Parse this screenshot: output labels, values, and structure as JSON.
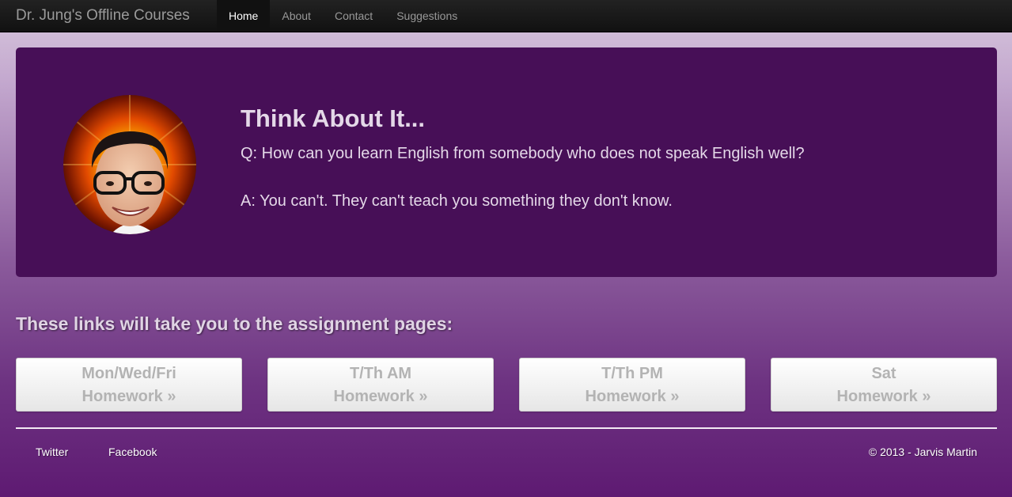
{
  "navbar": {
    "brand": "Dr. Jung's Offline Courses",
    "items": [
      {
        "label": "Home",
        "active": true
      },
      {
        "label": "About",
        "active": false
      },
      {
        "label": "Contact",
        "active": false
      },
      {
        "label": "Suggestions",
        "active": false
      }
    ]
  },
  "hero": {
    "title": "Think About It...",
    "question": "Q: How can you learn English from somebody who does not speak English well?",
    "answer": "A: You can't. They can't teach you something they don't know."
  },
  "links": {
    "heading": "These links will take you to the assignment pages:",
    "buttons": [
      {
        "line1": "Mon/Wed/Fri",
        "line2": "Homework »"
      },
      {
        "line1": "T/Th AM",
        "line2": "Homework »"
      },
      {
        "line1": "T/Th PM",
        "line2": "Homework »"
      },
      {
        "line1": "Sat",
        "line2": "Homework »"
      }
    ]
  },
  "footer": {
    "links": [
      "Twitter",
      "Facebook"
    ],
    "copyright": "© 2013 - Jarvis Martin"
  },
  "colors": {
    "hero_bg": "#470f57",
    "navbar_bg": "#1a1a1a",
    "accent_purple": "#5e1a72"
  }
}
